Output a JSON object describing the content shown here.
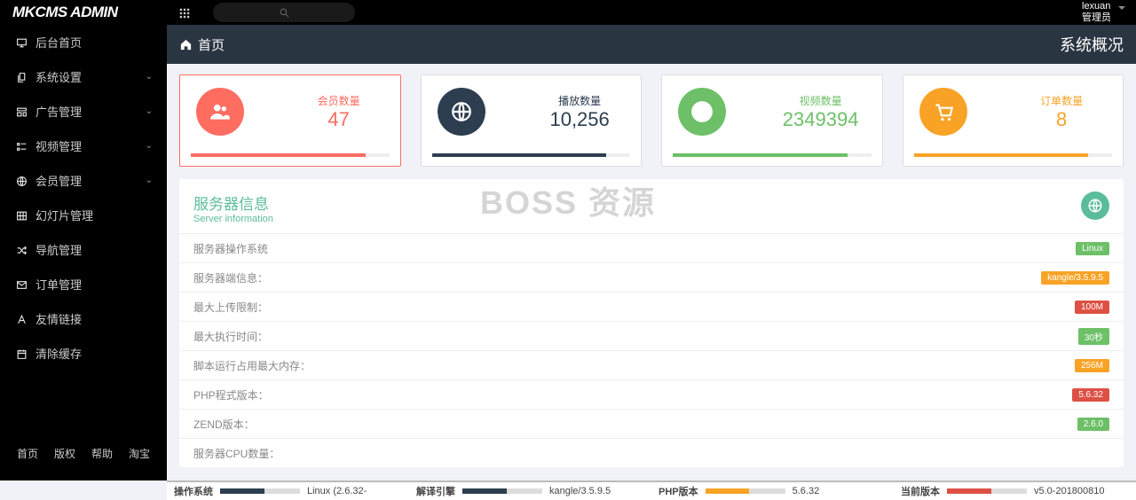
{
  "header": {
    "logo": "MKCMS ADMIN",
    "user_name": "lexuan",
    "user_role": "管理员"
  },
  "sidebar": {
    "items": [
      {
        "icon": "monitor",
        "label": "后台首页",
        "expandable": false
      },
      {
        "icon": "copy",
        "label": "系统设置",
        "expandable": true
      },
      {
        "icon": "layout",
        "label": "广告管理",
        "expandable": true
      },
      {
        "icon": "list",
        "label": "视频管理",
        "expandable": true
      },
      {
        "icon": "globe",
        "label": "会员管理",
        "expandable": true
      },
      {
        "icon": "grid",
        "label": "幻灯片管理",
        "expandable": false
      },
      {
        "icon": "shuffle",
        "label": "导航管理",
        "expandable": false
      },
      {
        "icon": "mail",
        "label": "订单管理",
        "expandable": false
      },
      {
        "icon": "font",
        "label": "友情链接",
        "expandable": false
      },
      {
        "icon": "calendar",
        "label": "清除缓存",
        "expandable": false
      }
    ],
    "bottom_links": [
      "首页",
      "版权",
      "帮助",
      "淘宝"
    ]
  },
  "breadcrumb": {
    "text": "首页",
    "page_title": "系统概况"
  },
  "stats": [
    {
      "label": "会员数量",
      "value": "47",
      "color": "red",
      "icon": "users"
    },
    {
      "label": "播放数量",
      "value": "10,256",
      "color": "blue",
      "icon": "globe"
    },
    {
      "label": "视频数量",
      "value": "2349394",
      "color": "green",
      "icon": "download"
    },
    {
      "label": "订单数量",
      "value": "8",
      "color": "orange",
      "icon": "cart"
    }
  ],
  "server_panel": {
    "title_cn": "服务器信息",
    "title_en": "Server information",
    "rows": [
      {
        "key": "服务器操作系统",
        "value": "Linux",
        "badge": "b-green"
      },
      {
        "key": "服务器端信息：",
        "value": "kangle/3.5.9.5",
        "badge": "b-orange"
      },
      {
        "key": "最大上传限制：",
        "value": "100M",
        "badge": "b-red"
      },
      {
        "key": "最大执行时间：",
        "value": "30秒",
        "badge": "b-green"
      },
      {
        "key": "脚本运行占用最大内存：",
        "value": "256M",
        "badge": "b-orange"
      },
      {
        "key": "PHP程式版本：",
        "value": "5.6.32",
        "badge": "b-red"
      },
      {
        "key": "ZEND版本：",
        "value": "2.6.0",
        "badge": "b-green"
      },
      {
        "key": "服务器CPU数量：",
        "value": "",
        "badge": ""
      }
    ]
  },
  "watermark": "BOSS 资源",
  "footer": [
    {
      "label": "操作系统",
      "value": "Linux (2.6.32-",
      "color": "f-blue",
      "pct": 55
    },
    {
      "label": "解译引擎",
      "value": "kangle/3.5.9.5",
      "color": "f-blue",
      "pct": 55
    },
    {
      "label": "PHP版本",
      "value": "5.6.32",
      "color": "f-orange",
      "pct": 55
    },
    {
      "label": "当前版本",
      "value": "v5.0-201800810",
      "color": "f-red",
      "pct": 55
    }
  ]
}
